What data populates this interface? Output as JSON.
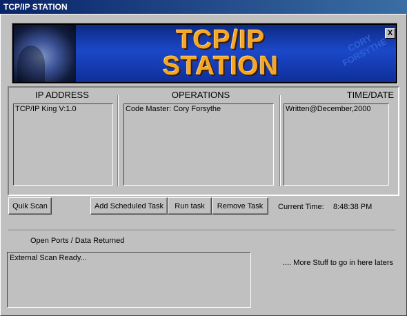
{
  "window": {
    "title": "TCP/IP STATION"
  },
  "banner": {
    "logo_line1": "TCP/IP",
    "logo_line2": "STATION",
    "signature_line1": "CORY",
    "signature_line2": "FORSYTHE",
    "close_label": "X"
  },
  "columns": [
    {
      "header": "IP ADDRESS",
      "item": "TCP/IP King V:1.0"
    },
    {
      "header": "OPERATIONS",
      "item": "Code Master: Cory Forsythe"
    },
    {
      "header": "TIME/DATE",
      "item": "Written@December,2000"
    }
  ],
  "toolbar": {
    "quick_scan": "Quik Scan",
    "add_scheduled": "Add Scheduled Task",
    "run_task": "Run task",
    "remove_task": "Remove Task",
    "current_time_label": "Current Time:",
    "current_time_value": "8:48:38 PM"
  },
  "output": {
    "section_label": "Open Ports / Data Returned",
    "text": "External Scan Ready...",
    "note": ".... More Stuff to go in here laters"
  }
}
